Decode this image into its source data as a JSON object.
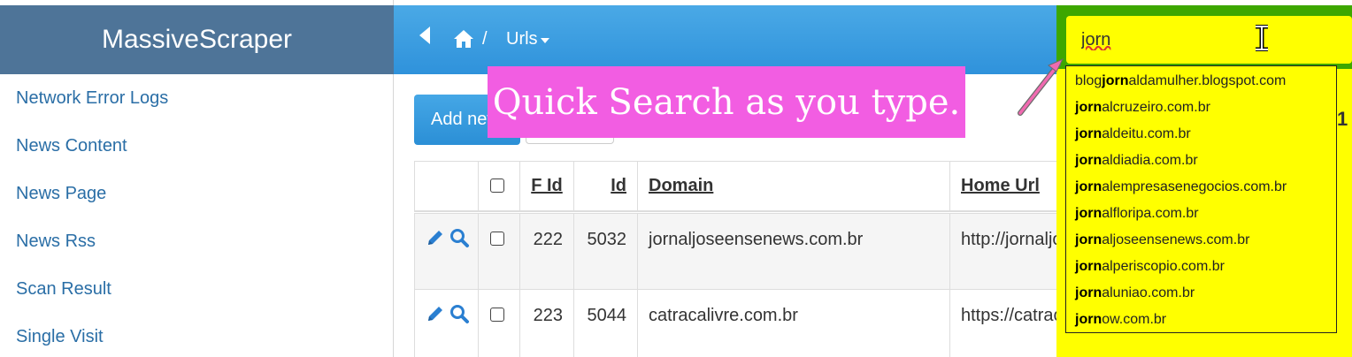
{
  "app": {
    "title": "MassiveScraper"
  },
  "sidebar": {
    "items": [
      {
        "label": "Network Error Logs"
      },
      {
        "label": "News Content"
      },
      {
        "label": "News Page"
      },
      {
        "label": "News Rss"
      },
      {
        "label": "Scan Result"
      },
      {
        "label": "Single Visit"
      }
    ]
  },
  "breadcrumb": {
    "separator": "/",
    "current": "Urls"
  },
  "search": {
    "value": "jorn"
  },
  "suggestions": [
    {
      "prefix": "blog",
      "match": "jorn",
      "suffix": "aldamulher.blogspot.com"
    },
    {
      "prefix": "",
      "match": "jorn",
      "suffix": "alcruzeiro.com.br"
    },
    {
      "prefix": "",
      "match": "jorn",
      "suffix": "aldeitu.com.br"
    },
    {
      "prefix": "",
      "match": "jorn",
      "suffix": "aldiadia.com.br"
    },
    {
      "prefix": "",
      "match": "jorn",
      "suffix": "alempresasenegocios.com.br"
    },
    {
      "prefix": "",
      "match": "jorn",
      "suffix": "alfloripa.com.br"
    },
    {
      "prefix": "",
      "match": "jorn",
      "suffix": "aljoseensenews.com.br"
    },
    {
      "prefix": "",
      "match": "jorn",
      "suffix": "alperiscopio.com.br"
    },
    {
      "prefix": "",
      "match": "jorn",
      "suffix": "aluniao.com.br"
    },
    {
      "prefix": "",
      "match": "jorn",
      "suffix": "ow.com.br"
    }
  ],
  "callout": {
    "text": "Quick Search as you type."
  },
  "toolbar": {
    "add_label": "Add new",
    "page_count_fragment": "1"
  },
  "table": {
    "headers": {
      "fid": "F Id",
      "id": "Id",
      "domain": "Domain",
      "home_url": "Home Url"
    },
    "rows": [
      {
        "fid": "222",
        "id": "5032",
        "domain": "jornaljoseensenews.com.br",
        "home_url": "http://jornaljoseensenews.com.br"
      },
      {
        "fid": "223",
        "id": "5044",
        "domain": "catracalivre.com.br",
        "home_url": "https://catracalivre.com.br"
      }
    ]
  },
  "colors": {
    "brand_bg": "#4e7498",
    "topbar": "#3a9de0",
    "link": "#2a6ea6",
    "highlight": "#ffff00",
    "search_border": "#3da700",
    "callout": "#f25de2"
  },
  "icons": [
    "back-icon",
    "home-icon",
    "caret-down-icon",
    "text-cursor-icon",
    "edit-pencil-icon",
    "search-magnifier-icon",
    "checkbox-icon",
    "pointer-arrow-icon"
  ]
}
